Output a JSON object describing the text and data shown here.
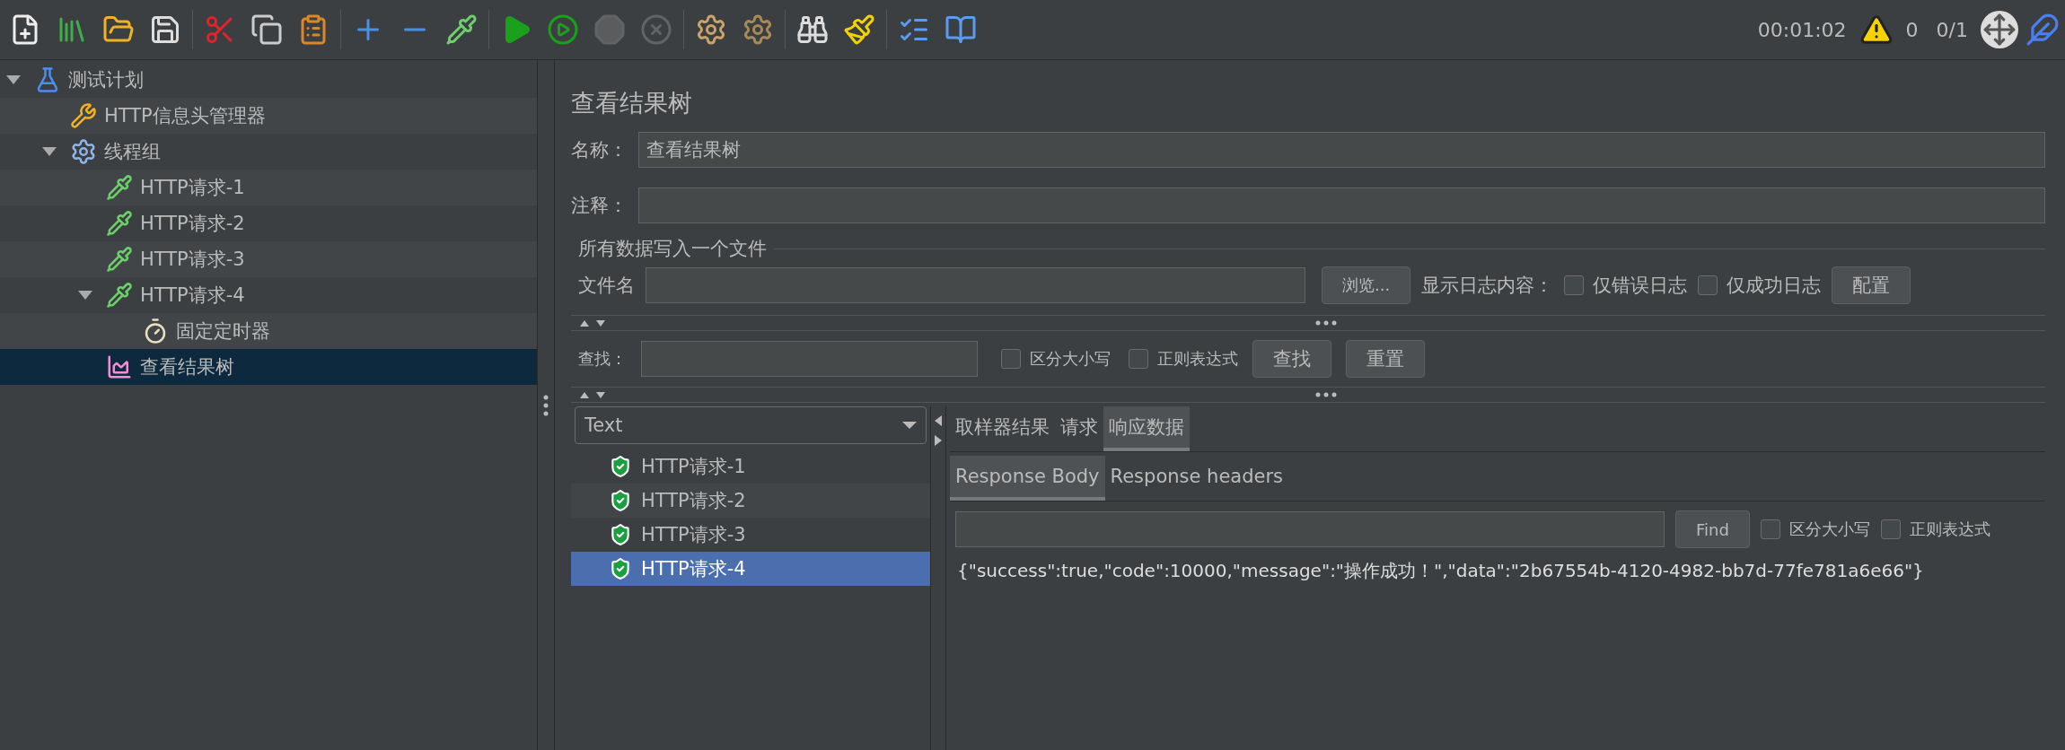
{
  "toolbar": [
    [
      {
        "kind": "new",
        "disabled": false
      },
      {
        "kind": "templates",
        "disabled": false
      },
      {
        "kind": "open",
        "disabled": false
      },
      {
        "kind": "save",
        "disabled": false
      }
    ],
    [
      {
        "kind": "cut",
        "disabled": false
      },
      {
        "kind": "copy",
        "disabled": false
      },
      {
        "kind": "paste",
        "disabled": false
      }
    ],
    [
      {
        "kind": "expand",
        "disabled": false
      },
      {
        "kind": "collapse",
        "disabled": false
      },
      {
        "kind": "toggle",
        "disabled": false
      }
    ],
    [
      {
        "kind": "start",
        "disabled": false
      },
      {
        "kind": "start_no_pause",
        "disabled": false
      },
      {
        "kind": "stop",
        "disabled": true
      },
      {
        "kind": "shutdown",
        "disabled": true
      }
    ],
    [
      {
        "kind": "clear",
        "disabled": false
      },
      {
        "kind": "clear_all",
        "disabled": false
      }
    ],
    [
      {
        "kind": "search",
        "disabled": false
      },
      {
        "kind": "reset_search",
        "disabled": false
      }
    ],
    [
      {
        "kind": "functions",
        "disabled": false
      },
      {
        "kind": "help",
        "disabled": false
      }
    ]
  ],
  "status": {
    "elapsed": "00:01:02",
    "warnings": "0",
    "threads": "0/1"
  },
  "tree": [
    {
      "label": "测试计划",
      "kind": "plan",
      "selected": false,
      "expanded": true,
      "children": [
        {
          "label": "HTTP信息头管理器",
          "kind": "config",
          "selected": false
        },
        {
          "label": "线程组",
          "kind": "threads",
          "selected": false,
          "expanded": true,
          "children": [
            {
              "label": "HTTP请求-1",
              "kind": "sampler",
              "selected": false
            },
            {
              "label": "HTTP请求-2",
              "kind": "sampler",
              "selected": false
            },
            {
              "label": "HTTP请求-3",
              "kind": "sampler",
              "selected": false
            },
            {
              "label": "HTTP请求-4",
              "kind": "sampler",
              "selected": false,
              "expanded": true,
              "children": [
                {
                  "label": "固定定时器",
                  "kind": "timer",
                  "selected": false
                }
              ]
            },
            {
              "label": "查看结果树",
              "kind": "listener",
              "selected": true
            }
          ]
        }
      ]
    }
  ],
  "panel": {
    "title": "查看结果树",
    "name_field": {
      "label": "名称：",
      "value": "查看结果树"
    },
    "comment_field": {
      "label": "注释："
    },
    "file_section": {
      "legend": "所有数据写入一个文件",
      "file_label": "文件名",
      "browse_button": "浏览...",
      "log_label": "显示日志内容：",
      "options": [
        {
          "label": "仅错误日志",
          "checked": false
        },
        {
          "label": "仅成功日志",
          "checked": false
        }
      ],
      "config_button": "配置"
    },
    "search": {
      "label": "查找：",
      "options": [
        {
          "label": "区分大小写",
          "checked": false
        },
        {
          "label": "正则表达式",
          "checked": false
        }
      ],
      "buttons": [
        "查找",
        "重置"
      ]
    },
    "results": {
      "renderer": "Text",
      "samples": [
        {
          "label": "HTTP请求-1",
          "selected": false
        },
        {
          "label": "HTTP请求-2",
          "selected": false
        },
        {
          "label": "HTTP请求-3",
          "selected": false
        },
        {
          "label": "HTTP请求-4",
          "selected": true
        }
      ],
      "tabs": [
        {
          "label": "取样器结果",
          "selected": false
        },
        {
          "label": "请求",
          "selected": false
        },
        {
          "label": "响应数据",
          "selected": true
        }
      ],
      "sub_tabs": [
        {
          "label": "Response Body",
          "selected": true
        },
        {
          "label": "Response headers",
          "selected": false
        }
      ],
      "find_button": "Find",
      "find_options": [
        {
          "label": "区分大小写",
          "checked": false
        },
        {
          "label": "正则表达式",
          "checked": false
        }
      ],
      "body": "{\"success\":true,\"code\":10000,\"message\":\"操作成功！\",\"data\":\"2b67554b-4120-4982-bb7d-77fe781a6e66\"}"
    }
  }
}
